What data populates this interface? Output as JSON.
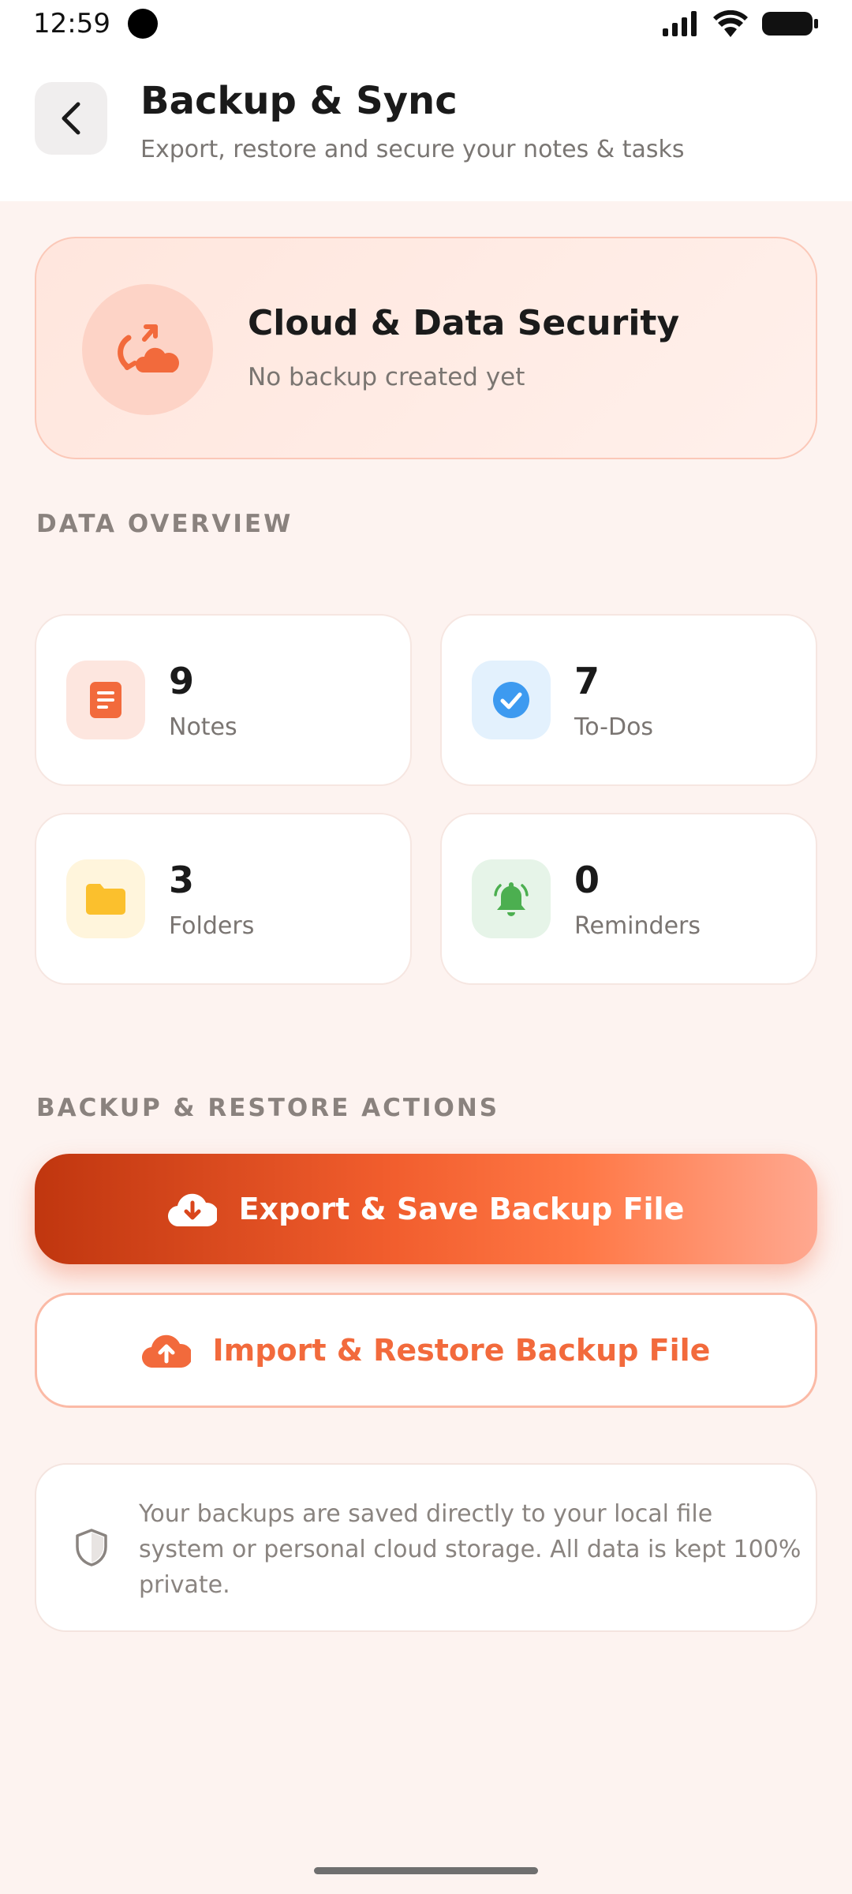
{
  "status_bar": {
    "time": "12:59"
  },
  "header": {
    "title": "Backup & Sync",
    "subtitle": "Export, restore and secure your notes & tasks"
  },
  "hero": {
    "title": "Cloud & Data Security",
    "subtitle": "No backup created yet"
  },
  "overview": {
    "section_label": "DATA OVERVIEW",
    "stats": [
      {
        "value": "9",
        "label": "Notes",
        "icon": "notes-icon",
        "color": "#f26a3c",
        "bg": "#fde6df"
      },
      {
        "value": "7",
        "label": "To-Dos",
        "icon": "check-circle-icon",
        "color": "#3d9af0",
        "bg": "#e3f1fd"
      },
      {
        "value": "3",
        "label": "Folders",
        "icon": "folder-icon",
        "color": "#fbc02d",
        "bg": "#fff5dc"
      },
      {
        "value": "0",
        "label": "Reminders",
        "icon": "bell-icon",
        "color": "#4caf50",
        "bg": "#e6f4e8"
      }
    ]
  },
  "actions": {
    "section_label": "BACKUP & RESTORE ACTIONS",
    "export_label": "Export & Save Backup File",
    "import_label": "Import & Restore Backup File"
  },
  "info": {
    "text": "Your backups are saved directly to your local file system or personal cloud storage. All data is kept 100% private."
  },
  "colors": {
    "accent": "#f26a3c",
    "background": "#fdf3f0"
  }
}
